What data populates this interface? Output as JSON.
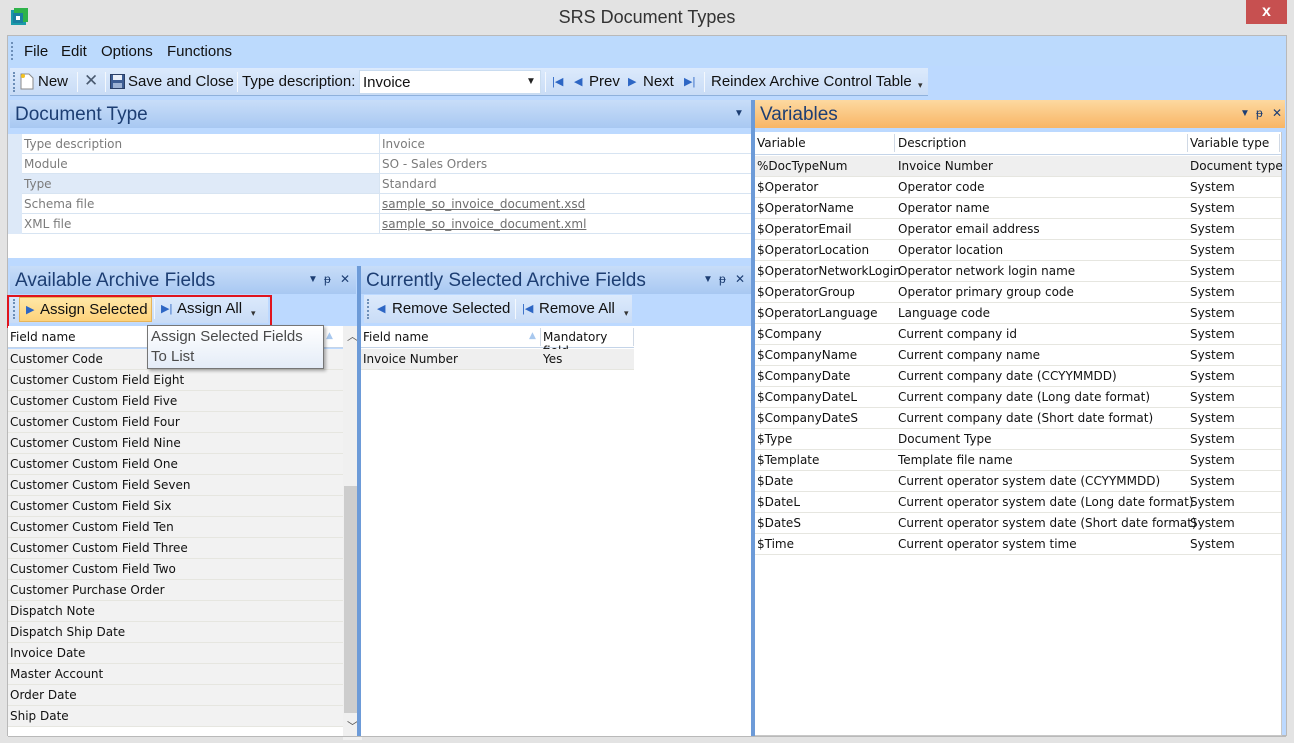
{
  "window": {
    "title": "SRS Document Types",
    "close_label": "x"
  },
  "menubar": {
    "items": [
      "File",
      "Edit",
      "Options",
      "Functions"
    ]
  },
  "toolbar": {
    "new_label": "New",
    "save_close_label": "Save and Close",
    "type_description_label": "Type description:",
    "type_description_value": "Invoice",
    "prev_label": "Prev",
    "next_label": "Next",
    "reindex_label": "Reindex Archive Control Table"
  },
  "document_type": {
    "title": "Document Type",
    "rows": [
      {
        "key": "Type description",
        "value": "Invoice",
        "link": false
      },
      {
        "key": "Module",
        "value": "SO - Sales Orders",
        "link": false
      },
      {
        "key": "Type",
        "value": "Standard",
        "link": false
      },
      {
        "key": "Schema file",
        "value": "sample_so_invoice_document.xsd",
        "link": true
      },
      {
        "key": "XML file",
        "value": "sample_so_invoice_document.xml",
        "link": true
      }
    ]
  },
  "available_fields": {
    "title": "Available Archive Fields",
    "assign_selected_label": "Assign Selected",
    "assign_all_label": "Assign All",
    "tooltip": "Assign Selected Fields To List",
    "column_header": "Field name",
    "rows": [
      "Customer Code",
      "Customer Custom Field Eight",
      "Customer Custom Field Five",
      "Customer Custom Field Four",
      "Customer Custom Field Nine",
      "Customer Custom Field One",
      "Customer Custom Field Seven",
      "Customer Custom Field Six",
      "Customer Custom Field Ten",
      "Customer Custom Field Three",
      "Customer Custom Field Two",
      "Customer Purchase Order",
      "Dispatch Note",
      "Dispatch Ship Date",
      "Invoice Date",
      "Master Account",
      "Order Date",
      "Ship Date"
    ]
  },
  "selected_fields": {
    "title": "Currently Selected Archive Fields",
    "remove_selected_label": "Remove Selected",
    "remove_all_label": "Remove All",
    "columns": [
      "Field name",
      "Mandatory field"
    ],
    "rows": [
      {
        "field": "Invoice Number",
        "mandatory": "Yes"
      }
    ]
  },
  "variables": {
    "title": "Variables",
    "columns": [
      "Variable",
      "Description",
      "Variable type"
    ],
    "rows": [
      {
        "var": "%DocTypeNum",
        "desc": "Invoice Number",
        "type": "Document type"
      },
      {
        "var": "$Operator",
        "desc": "Operator code",
        "type": "System"
      },
      {
        "var": "$OperatorName",
        "desc": "Operator name",
        "type": "System"
      },
      {
        "var": "$OperatorEmail",
        "desc": "Operator email address",
        "type": "System"
      },
      {
        "var": "$OperatorLocation",
        "desc": "Operator location",
        "type": "System"
      },
      {
        "var": "$OperatorNetworkLogin",
        "desc": "Operator network login name",
        "type": "System"
      },
      {
        "var": "$OperatorGroup",
        "desc": "Operator primary group code",
        "type": "System"
      },
      {
        "var": "$OperatorLanguage",
        "desc": "Language code",
        "type": "System"
      },
      {
        "var": "$Company",
        "desc": "Current company id",
        "type": "System"
      },
      {
        "var": "$CompanyName",
        "desc": "Current company name",
        "type": "System"
      },
      {
        "var": "$CompanyDate",
        "desc": "Current company date (CCYYMMDD)",
        "type": "System"
      },
      {
        "var": "$CompanyDateL",
        "desc": "Current company date (Long date format)",
        "type": "System"
      },
      {
        "var": "$CompanyDateS",
        "desc": "Current company date (Short date format)",
        "type": "System"
      },
      {
        "var": "$Type",
        "desc": "Document Type",
        "type": "System"
      },
      {
        "var": "$Template",
        "desc": "Template file name",
        "type": "System"
      },
      {
        "var": "$Date",
        "desc": "Current operator system date (CCYYMMDD)",
        "type": "System"
      },
      {
        "var": "$DateL",
        "desc": "Current operator system date (Long date format)",
        "type": "System"
      },
      {
        "var": "$DateS",
        "desc": "Current operator system date (Short date format)",
        "type": "System"
      },
      {
        "var": "$Time",
        "desc": "Current operator system time",
        "type": "System"
      }
    ]
  },
  "colors": {
    "accent_blue": "#bcd9ff",
    "variables_header": "#f8b565",
    "close_button": "#c75050",
    "highlight_outline": "#e0141e"
  }
}
